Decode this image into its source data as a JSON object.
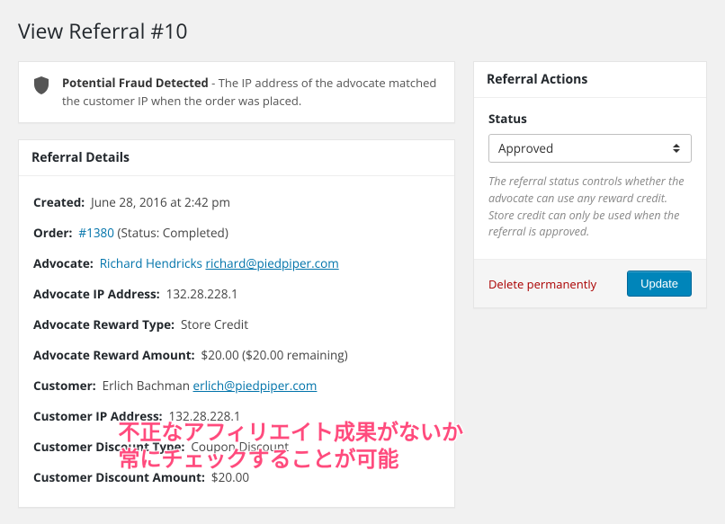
{
  "page": {
    "title": "View Referral #10"
  },
  "fraud_notice": {
    "title": "Potential Fraud Detected",
    "rest": " - The IP address of the advocate matched the customer IP when the order was placed."
  },
  "details": {
    "heading": "Referral Details",
    "created": {
      "label": "Created:",
      "value": "June 28, 2016 at 2:42 pm"
    },
    "order": {
      "label": "Order:",
      "link": "#1380",
      "status": "(Status: Completed)"
    },
    "advocate": {
      "label": "Advocate:",
      "name": "Richard Hendricks",
      "email": "richard@piedpiper.com"
    },
    "adv_ip": {
      "label": "Advocate IP Address:",
      "value": "132.28.228.1"
    },
    "adv_rt": {
      "label": "Advocate Reward Type:",
      "value": "Store Credit"
    },
    "adv_ra": {
      "label": "Advocate Reward Amount:",
      "value": "$20.00 ($20.00 remaining)"
    },
    "customer": {
      "label": "Customer:",
      "name": "Erlich Bachman",
      "email": "erlich@piedpiper.com"
    },
    "cust_ip": {
      "label": "Customer IP Address:",
      "value": "132.28.228.1"
    },
    "cust_dt": {
      "label": "Customer Discount Type:",
      "value": "Coupon Discount"
    },
    "cust_da": {
      "label": "Customer Discount Amount:",
      "value": "$20.00"
    }
  },
  "actions": {
    "heading": "Referral Actions",
    "status_label": "Status",
    "status_value": "Approved",
    "help": "The referral status controls whether the advocate can use any reward credit. Store credit can only be used when the referral is approved.",
    "delete": "Delete permanently",
    "update": "Update"
  },
  "overlay": {
    "line1": "不正なアフィリエイト成果がないか",
    "line2": "常にチェックすることが可能"
  }
}
